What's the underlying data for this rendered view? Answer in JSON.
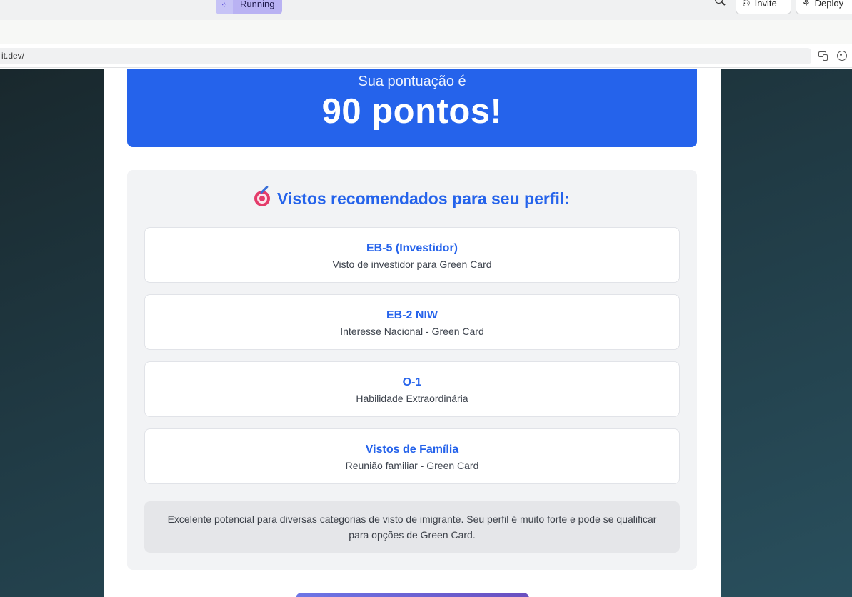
{
  "toolbar": {
    "run_label": "Running",
    "run_icon": "grid-dots-icon",
    "search_icon": "search-icon",
    "invite_label": "Invite",
    "invite_icon": "add-user-icon",
    "deploy_label": "Deploy",
    "deploy_icon": "deploy-icon"
  },
  "address_bar": {
    "url": "it.dev/",
    "icons": [
      "devices-icon",
      "palette-icon"
    ]
  },
  "score": {
    "intro": "Sua pontuação é",
    "value": "90 pontos!"
  },
  "recommendations": {
    "title": "Vistos recomendados para seu perfil:",
    "title_icon": "target-icon",
    "items": [
      {
        "name": "EB-5 (Investidor)",
        "desc": "Visto de investidor para Green Card"
      },
      {
        "name": "EB-2 NIW",
        "desc": "Interesse Nacional - Green Card"
      },
      {
        "name": "O-1",
        "desc": "Habilidade Extraordinária"
      },
      {
        "name": "Vistos de Família",
        "desc": "Reunião familiar - Green Card"
      }
    ],
    "summary": "Excelente potencial para diversas categorias de visto de imigrante. Seu perfil é muito forte e pode se qualificar para opções de Green Card."
  },
  "colors": {
    "accent": "#2563eb",
    "run_button": "#b9b2f3",
    "panel": "#f2f3f5"
  }
}
